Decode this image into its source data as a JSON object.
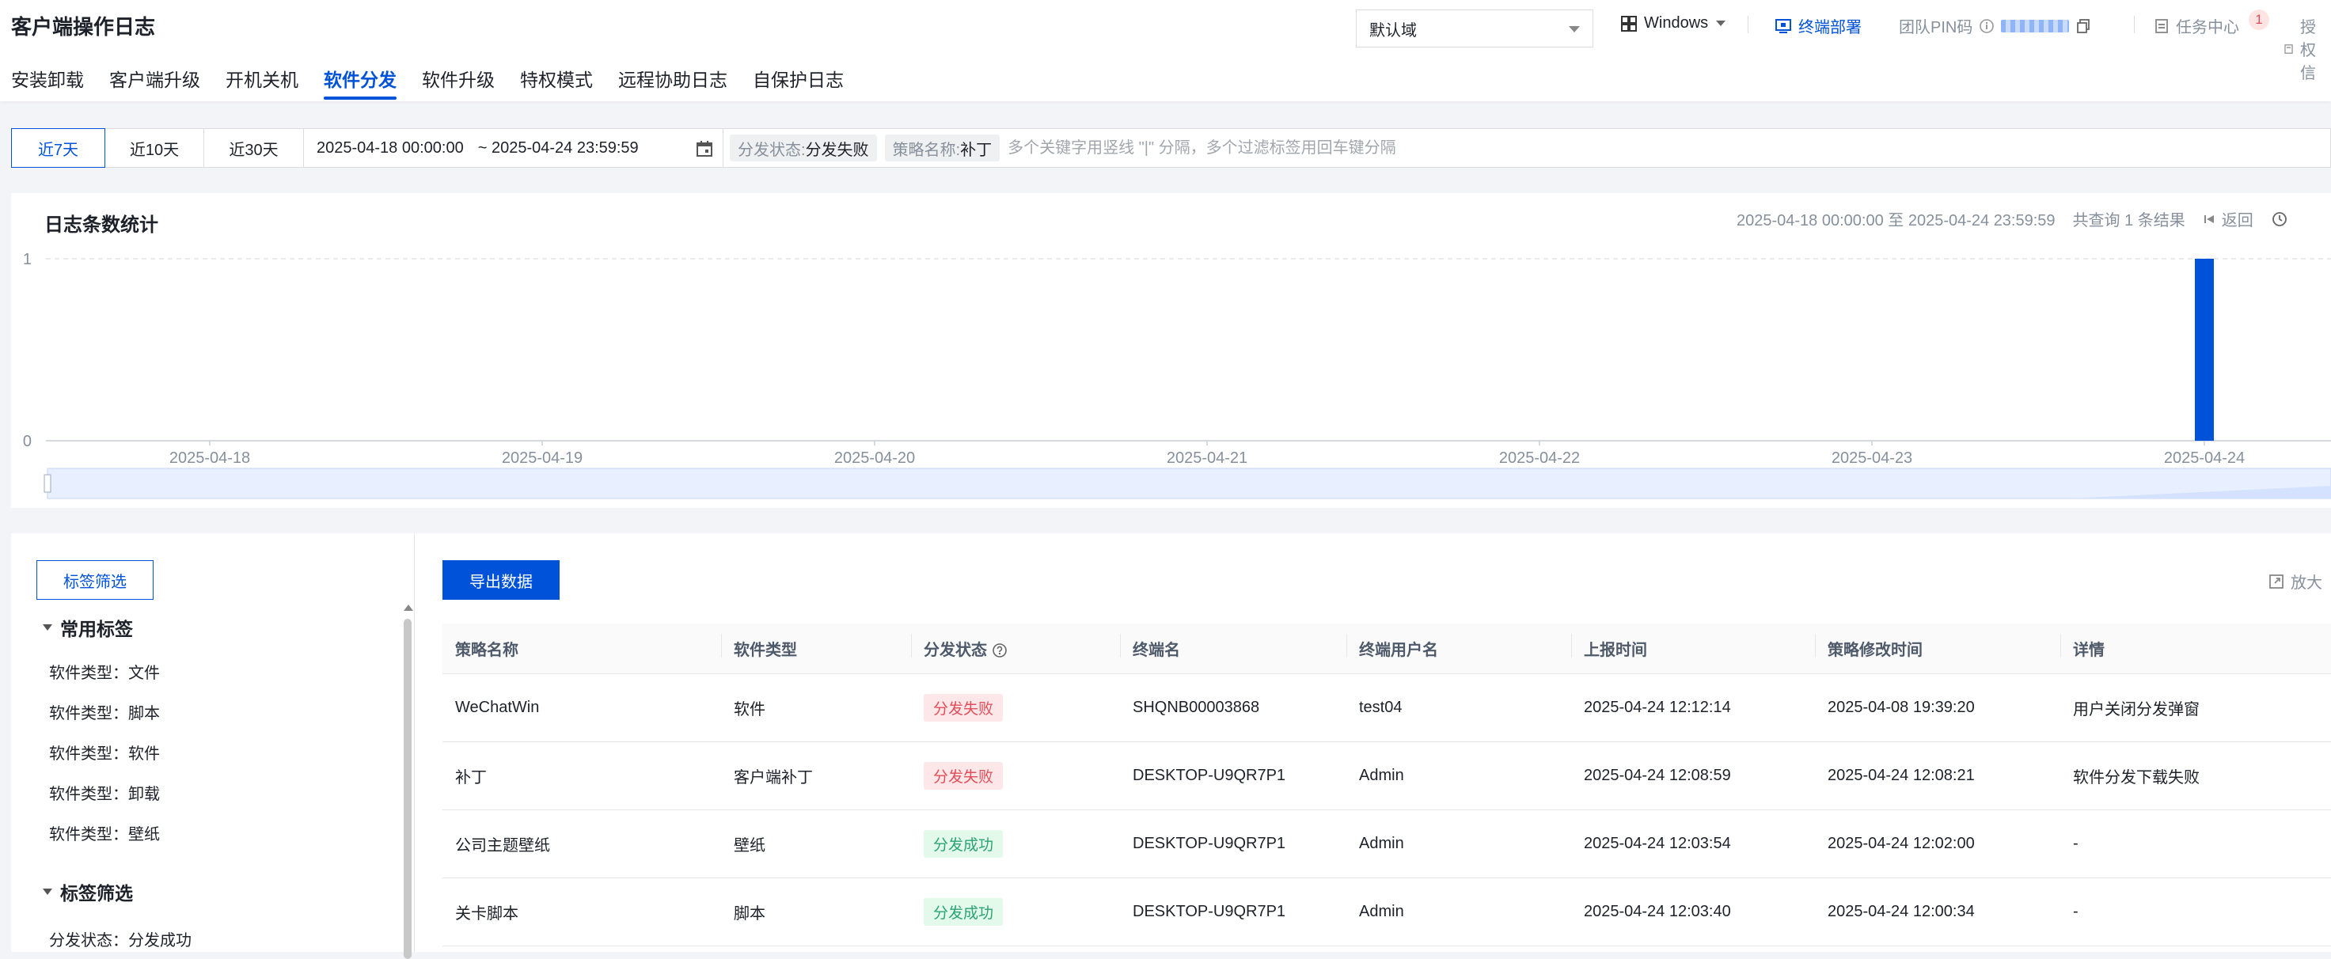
{
  "header": {
    "title": "客户端操作日志",
    "domain_select": "默认域",
    "os_select": "Windows",
    "deploy_label": "终端部署",
    "pin_label": "团队PIN码",
    "task_center": "任务中心",
    "task_badge": "1",
    "auth_label": "授权信"
  },
  "tabs": [
    {
      "label": "安装卸载"
    },
    {
      "label": "客户端升级"
    },
    {
      "label": "开机关机"
    },
    {
      "label": "软件分发",
      "active": true
    },
    {
      "label": "软件升级"
    },
    {
      "label": "特权模式"
    },
    {
      "label": "远程协助日志"
    },
    {
      "label": "自保护日志"
    }
  ],
  "filters": {
    "ranges": [
      "近7天",
      "近10天",
      "近30天"
    ],
    "active_range": "近7天",
    "date_start": "2025-04-18 00:00:00",
    "date_end": "~ 2025-04-24 23:59:59",
    "chips": [
      {
        "key": "分发状态:",
        "value": "分发失败"
      },
      {
        "key": "策略名称:",
        "value": "补丁"
      }
    ],
    "search_placeholder": "多个关键字用竖线 \"|\" 分隔，多个过滤标签用回车键分隔"
  },
  "chart_panel": {
    "title": "日志条数统计",
    "range_text": "2025-04-18 00:00:00 至 2025-04-24 23:59:59",
    "result_text": "共查询 1 条结果",
    "back_label": "返回"
  },
  "chart_data": {
    "type": "bar",
    "categories": [
      "2025-04-18",
      "2025-04-19",
      "2025-04-20",
      "2025-04-21",
      "2025-04-22",
      "2025-04-23",
      "2025-04-24"
    ],
    "values": [
      0,
      0,
      0,
      0,
      0,
      0,
      1
    ],
    "yticks": [
      "0",
      "1"
    ],
    "ylim": [
      0,
      1
    ],
    "grid": true,
    "bar_color": "#0052d9"
  },
  "left_pane": {
    "filter_button": "标签筛选",
    "common_group": "常用标签",
    "common_tags": [
      "软件类型：文件",
      "软件类型：脚本",
      "软件类型：软件",
      "软件类型：卸载",
      "软件类型：壁纸"
    ],
    "filter_group": "标签筛选",
    "filter_tags": [
      "分发状态：分发成功"
    ]
  },
  "table": {
    "export_label": "导出数据",
    "zoom_label": "放大",
    "columns": [
      "策略名称",
      "软件类型",
      "分发状态",
      "终端名",
      "终端用户名",
      "上报时间",
      "策略修改时间",
      "详情"
    ],
    "rows": [
      {
        "policy": "WeChatWin",
        "type": "软件",
        "status": "分发失败",
        "status_kind": "fail",
        "terminal": "SHQNB00003868",
        "user": "test04",
        "report_time": "2025-04-24 12:12:14",
        "modify_time": "2025-04-08 19:39:20",
        "detail": "用户关闭分发弹窗"
      },
      {
        "policy": "补丁",
        "type": "客户端补丁",
        "status": "分发失败",
        "status_kind": "fail",
        "terminal": "DESKTOP-U9QR7P1",
        "user": "Admin",
        "report_time": "2025-04-24 12:08:59",
        "modify_time": "2025-04-24 12:08:21",
        "detail": "软件分发下载失败"
      },
      {
        "policy": "公司主题壁纸",
        "type": "壁纸",
        "status": "分发成功",
        "status_kind": "ok",
        "terminal": "DESKTOP-U9QR7P1",
        "user": "Admin",
        "report_time": "2025-04-24 12:03:54",
        "modify_time": "2025-04-24 12:02:00",
        "detail": "-"
      },
      {
        "policy": "关卡脚本",
        "type": "脚本",
        "status": "分发成功",
        "status_kind": "ok",
        "terminal": "DESKTOP-U9QR7P1",
        "user": "Admin",
        "report_time": "2025-04-24 12:03:40",
        "modify_time": "2025-04-24 12:00:34",
        "detail": "-"
      }
    ]
  }
}
